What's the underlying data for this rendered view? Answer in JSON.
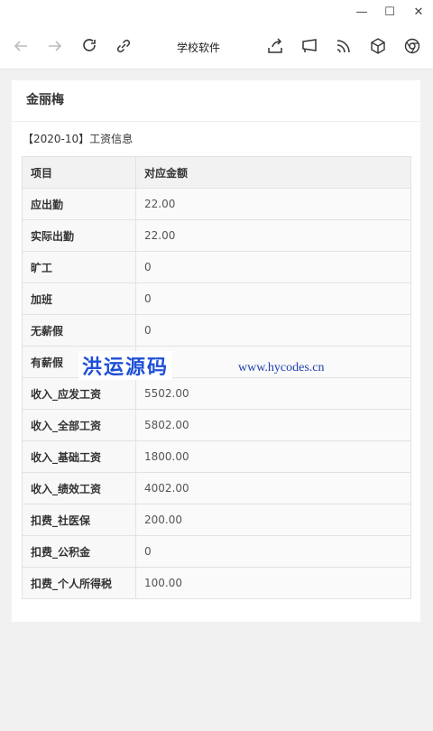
{
  "window": {
    "minimize": "—",
    "maximize": "☐",
    "close": "✕"
  },
  "toolbar": {
    "title": "学校软件"
  },
  "card": {
    "name": "金丽梅",
    "period": "【2020-10】工资信息",
    "table": {
      "headers": [
        "项目",
        "对应金额"
      ],
      "rows": [
        {
          "k": "应出勤",
          "v": "22.00"
        },
        {
          "k": "实际出勤",
          "v": "22.00"
        },
        {
          "k": "旷工",
          "v": "0"
        },
        {
          "k": "加班",
          "v": "0"
        },
        {
          "k": "无薪假",
          "v": "0"
        },
        {
          "k": "有薪假",
          "v": ""
        },
        {
          "k": "收入_应发工资",
          "v": "5502.00"
        },
        {
          "k": "收入_全部工资",
          "v": "5802.00"
        },
        {
          "k": "收入_基础工资",
          "v": "1800.00"
        },
        {
          "k": "收入_绩效工资",
          "v": "4002.00"
        },
        {
          "k": "扣费_社医保",
          "v": "200.00"
        },
        {
          "k": "扣费_公积金",
          "v": "0"
        },
        {
          "k": "扣费_个人所得税",
          "v": "100.00"
        }
      ]
    }
  },
  "watermark": {
    "cn": "洪运源码",
    "url": "www.hycodes.cn"
  }
}
